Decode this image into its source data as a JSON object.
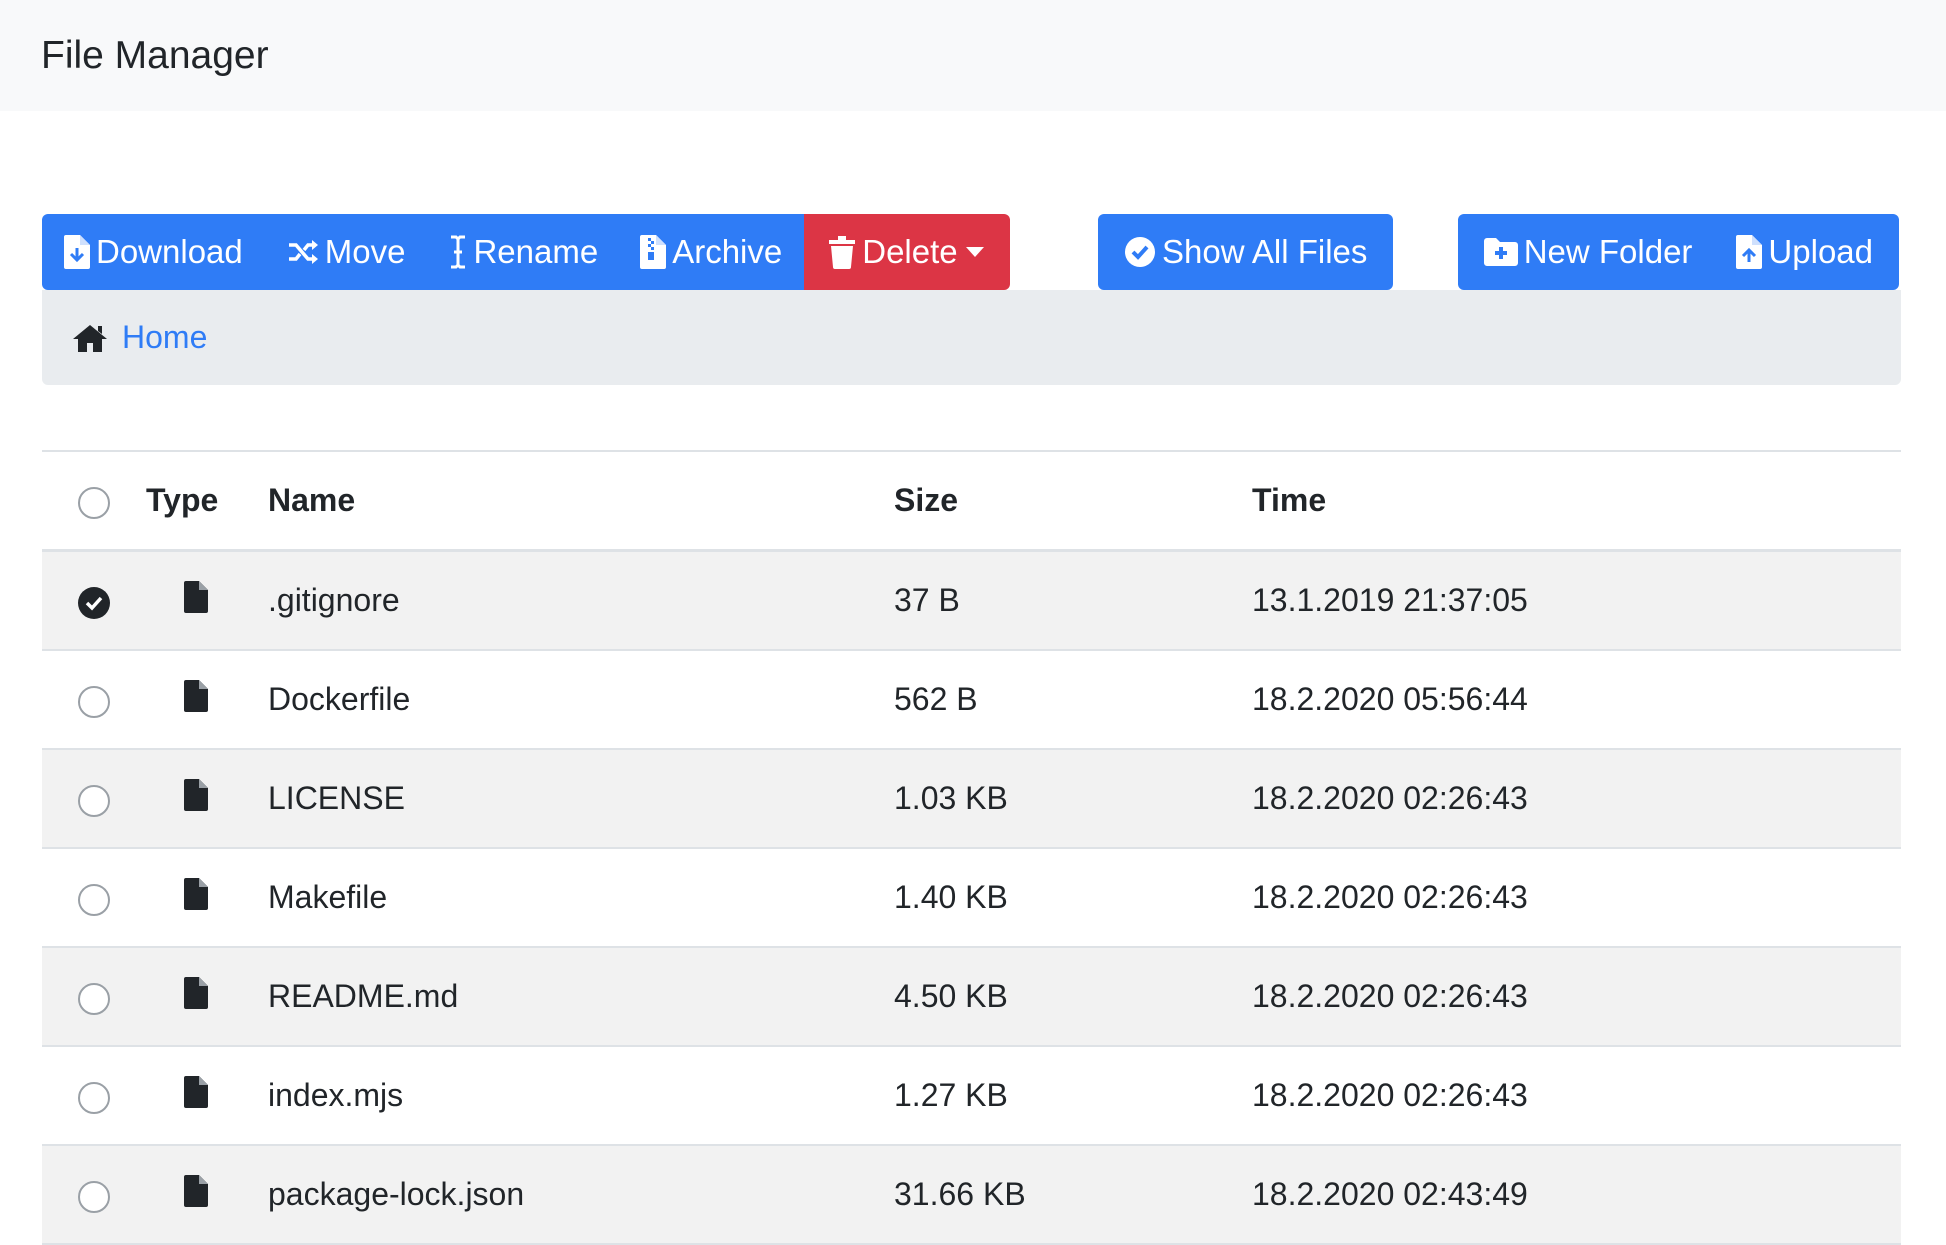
{
  "app": {
    "title": "File Manager"
  },
  "toolbar": {
    "download_label": "Download",
    "move_label": "Move",
    "rename_label": "Rename",
    "archive_label": "Archive",
    "delete_label": "Delete",
    "show_all_label": "Show All Files",
    "new_folder_label": "New Folder",
    "upload_label": "Upload"
  },
  "breadcrumb": {
    "items": [
      "Home"
    ]
  },
  "table": {
    "headers": {
      "type": "Type",
      "name": "Name",
      "size": "Size",
      "time": "Time"
    },
    "rows": [
      {
        "name": ".gitignore",
        "size": "37 B",
        "time": "13.1.2019 21:37:05",
        "selected": true,
        "type_icon": "file-icon"
      },
      {
        "name": "Dockerfile",
        "size": "562 B",
        "time": "18.2.2020 05:56:44",
        "selected": false,
        "type_icon": "file-icon"
      },
      {
        "name": "LICENSE",
        "size": "1.03 KB",
        "time": "18.2.2020 02:26:43",
        "selected": false,
        "type_icon": "file-icon"
      },
      {
        "name": "Makefile",
        "size": "1.40 KB",
        "time": "18.2.2020 02:26:43",
        "selected": false,
        "type_icon": "file-icon"
      },
      {
        "name": "README.md",
        "size": "4.50 KB",
        "time": "18.2.2020 02:26:43",
        "selected": false,
        "type_icon": "file-icon"
      },
      {
        "name": "index.mjs",
        "size": "1.27 KB",
        "time": "18.2.2020 02:26:43",
        "selected": false,
        "type_icon": "file-icon"
      },
      {
        "name": "package-lock.json",
        "size": "31.66 KB",
        "time": "18.2.2020 02:43:49",
        "selected": false,
        "type_icon": "file-icon"
      }
    ]
  },
  "colors": {
    "primary": "#2f7cf6",
    "danger": "#dc3545",
    "navbar_bg": "#f8f9fa",
    "breadcrumb_bg": "#e9ecef",
    "stripe": "#f2f2f2"
  }
}
